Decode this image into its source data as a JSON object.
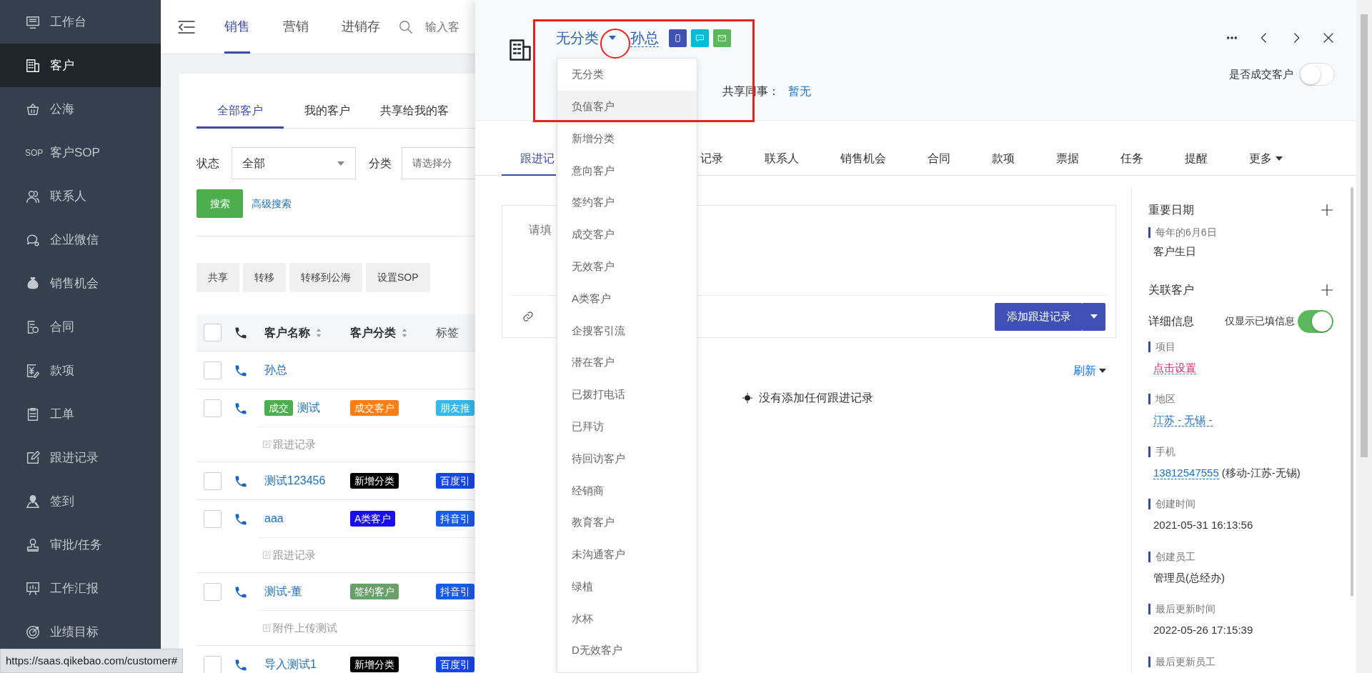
{
  "sidebar": {
    "items": [
      {
        "label": "工作台",
        "selected": false
      },
      {
        "label": "客户",
        "selected": true
      },
      {
        "label": "公海",
        "selected": false
      },
      {
        "label": "客户SOP",
        "icon_text": "SOP",
        "selected": false
      },
      {
        "label": "联系人",
        "selected": false
      },
      {
        "label": "企业微信",
        "selected": false
      },
      {
        "label": "销售机会",
        "selected": false
      },
      {
        "label": "合同",
        "selected": false
      },
      {
        "label": "款项",
        "selected": false
      },
      {
        "label": "工单",
        "selected": false
      },
      {
        "label": "跟进记录",
        "selected": false
      },
      {
        "label": "签到",
        "selected": false
      },
      {
        "label": "审批/任务",
        "selected": false
      },
      {
        "label": "工作汇报",
        "selected": false
      },
      {
        "label": "业绩目标",
        "selected": false
      }
    ]
  },
  "top_nav": {
    "tabs": [
      {
        "label": "销售",
        "selected": true
      },
      {
        "label": "营销",
        "selected": false
      },
      {
        "label": "进销存",
        "selected": false
      }
    ],
    "search": {
      "placeholder": "输入客"
    }
  },
  "customer_list": {
    "tabs": [
      {
        "label": "全部客户",
        "selected": true
      },
      {
        "label": "我的客户",
        "selected": false
      },
      {
        "label": "共享给我的客",
        "selected": false
      }
    ],
    "filters": [
      {
        "label": "状态",
        "value": "全部"
      },
      {
        "label": "分类",
        "placeholder": "请选择分"
      }
    ],
    "search_button": "搜索",
    "advanced_search": "高级搜索",
    "actions": [
      "共享",
      "转移",
      "转移到公海",
      "设置SOP"
    ],
    "table": {
      "header_checked": false,
      "columns": [
        {
          "label": "客户名称",
          "sortable": true
        },
        {
          "label": "客户分类",
          "sortable": true
        },
        {
          "label": "标签",
          "sortable": false
        }
      ],
      "rows": [
        {
          "checked": false,
          "name": "孙总"
        },
        {
          "checked": false,
          "status": {
            "text": "成交",
            "color": "#4cae4c"
          },
          "name": "测试",
          "category": {
            "text": "成交客户",
            "color": "#fd7e14"
          },
          "tag": {
            "text": "朋友推",
            "color": "#35b8ea"
          },
          "note": "跟进记录"
        },
        {
          "checked": false,
          "name": "测试123456",
          "category": {
            "text": "新增分类",
            "color": "#000000"
          },
          "tag": {
            "text": "百度引",
            "color": "#1546e6"
          }
        },
        {
          "checked": false,
          "name": "aaa",
          "category": {
            "text": "A类客户",
            "color": "#1a0cf0"
          },
          "tag": {
            "text": "抖音引",
            "color": "#1a5ae8"
          },
          "note": "跟进记录"
        },
        {
          "checked": false,
          "name": "测试-董",
          "category": {
            "text": "签约客户",
            "color": "#6a9f6a"
          },
          "tag": {
            "text": "抖音引",
            "color": "#1a5ae8"
          },
          "note": "附件上传测试"
        },
        {
          "checked": false,
          "name": "导入测试1",
          "category": {
            "text": "新增分类",
            "color": "#000000"
          },
          "tag": {
            "text": "百度引",
            "color": "#1546e6"
          }
        }
      ]
    }
  },
  "status_url": "https://saas.qikebao.com/customer#",
  "drawer": {
    "category": "无分类",
    "name": "孙总",
    "contact_buttons": [
      {
        "color": "#3f51b5"
      },
      {
        "color": "#00bcd4"
      },
      {
        "color": "#5cb85c"
      }
    ],
    "shared_label": "共享同事：",
    "shared_value": "暂无",
    "deal_toggle": {
      "label": "是否成交客户",
      "on": false
    },
    "tabs": [
      {
        "label": "跟进记",
        "selected": true
      },
      {
        "label": "记录",
        "selected": false
      },
      {
        "label": "联系人",
        "selected": false
      },
      {
        "label": "销售机会",
        "selected": false
      },
      {
        "label": "合同",
        "selected": false
      },
      {
        "label": "款项",
        "selected": false
      },
      {
        "label": "票据",
        "selected": false
      },
      {
        "label": "任务",
        "selected": false
      },
      {
        "label": "提醒",
        "selected": false
      },
      {
        "label": "更多",
        "selected": false,
        "dropdown": true
      }
    ],
    "note_placeholder": "请填",
    "add_button": "添加跟进记录",
    "refresh": "刷新",
    "empty_message": "没有添加任何跟进记录",
    "side_panel": {
      "important_dates": {
        "title": "重要日期",
        "items": [
          {
            "date": "每年的6月6日",
            "label": "客户生日"
          }
        ]
      },
      "related": {
        "title": "关联客户"
      },
      "details": {
        "title": "详细信息",
        "filter_toggle": {
          "label": "仅显示已填信息",
          "on": true
        },
        "fields": [
          {
            "kind": "unset",
            "label": "项目",
            "value": "点击设置"
          },
          {
            "kind": "link",
            "label": "地区",
            "value": "江苏 - 无锡 -"
          },
          {
            "kind": "link",
            "label": "手机",
            "value": "13812547555",
            "note": "(移动-江苏-无锡)"
          },
          {
            "kind": "text",
            "label": "创建时间",
            "value": "2021-05-31 16:13:56"
          },
          {
            "kind": "text",
            "label": "创建员工",
            "value": "管理员(总经办)"
          },
          {
            "kind": "text",
            "label": "最后更新时间",
            "value": "2022-05-26 17:15:39"
          },
          {
            "label": "最后更新员工"
          }
        ]
      }
    },
    "category_menu": {
      "items": [
        {
          "label": "无分类",
          "selected": false
        },
        {
          "label": "负值客户",
          "selected": true
        },
        {
          "label": "新增分类",
          "selected": false
        },
        {
          "label": "意向客户",
          "selected": false
        },
        {
          "label": "签约客户",
          "selected": false
        },
        {
          "label": "成交客户",
          "selected": false
        },
        {
          "label": "无效客户",
          "selected": false
        },
        {
          "label": "A类客户",
          "selected": false
        },
        {
          "label": "企搜客引流",
          "selected": false
        },
        {
          "label": "潜在客户",
          "selected": false
        },
        {
          "label": "已拨打电话",
          "selected": false
        },
        {
          "label": "已拜访",
          "selected": false
        },
        {
          "label": "待回访客户",
          "selected": false
        },
        {
          "label": "经销商",
          "selected": false
        },
        {
          "label": "教育客户",
          "selected": false
        },
        {
          "label": "未沟通客户",
          "selected": false
        },
        {
          "label": "绿植",
          "selected": false
        },
        {
          "label": "水杯",
          "selected": false
        },
        {
          "label": "D无效客户",
          "selected": false
        }
      ]
    },
    "annotations": [
      {
        "kind": "box"
      },
      {
        "kind": "circle"
      }
    ]
  }
}
